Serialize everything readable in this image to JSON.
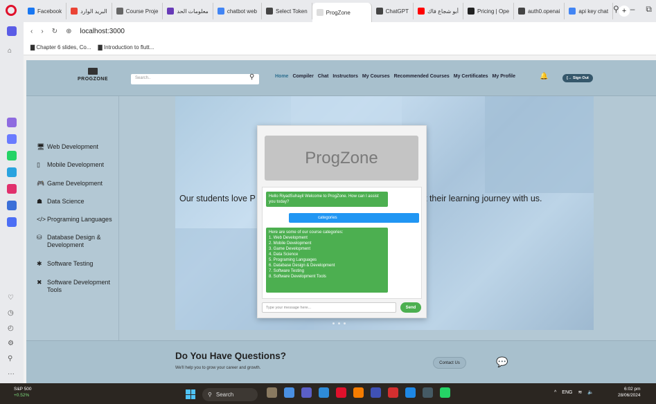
{
  "browser": {
    "tabs": [
      {
        "label": "Facebook",
        "color": "#1877f2"
      },
      {
        "label": "البريد الوارد",
        "color": "#ea4335"
      },
      {
        "label": "Course Proje",
        "color": "#666666"
      },
      {
        "label": "معلومات الحد",
        "color": "#673ab7"
      },
      {
        "label": "chatbot web",
        "color": "#4285f4"
      },
      {
        "label": "Select Token",
        "color": "#444444"
      },
      {
        "label": "ProgZone",
        "color": "#dddddd"
      },
      {
        "label": "ChatGPT",
        "color": "#444444"
      },
      {
        "label": "أبو شجاع فاك",
        "color": "#ff0000"
      },
      {
        "label": "Pricing | Ope",
        "color": "#222222"
      },
      {
        "label": "auth0.openai",
        "color": "#444444"
      },
      {
        "label": "api key chat",
        "color": "#4285f4"
      }
    ],
    "url": "localhost:3000",
    "bookmarks": [
      "Chapter 6 slides, Co...",
      "Introduction to flutt..."
    ]
  },
  "site": {
    "logo": "PROGZONE",
    "search_placeholder": "Search..",
    "nav": [
      "Home",
      "Compiler",
      "Chat",
      "Instructors",
      "My Courses",
      "Recommended Courses",
      "My Certificates",
      "My Profile"
    ],
    "signout": "[→ Sign Out"
  },
  "categories": [
    {
      "label": "Web Development",
      "icon": "🖥"
    },
    {
      "label": "Mobile Development",
      "icon": "▯"
    },
    {
      "label": "Game Development",
      "icon": "🎮"
    },
    {
      "label": "Data Science",
      "icon": "☗"
    },
    {
      "label": "Programing Languages",
      "icon": "</>"
    },
    {
      "label": "Database Design & Development",
      "icon": "⛁"
    },
    {
      "label": "Software Testing",
      "icon": "✱"
    },
    {
      "label": "Software Development Tools",
      "icon": "✖"
    }
  ],
  "hero": {
    "text_left": "Our students love P",
    "text_right": "t their learning journey with us."
  },
  "chat": {
    "header": "ProgZone",
    "bot_greeting": "Hello RiyadSuhayil Welcome to ProgZone. How can I assist you today?",
    "user_message": "categories",
    "bot_reply_title": "Here are some of our course categories:",
    "bot_reply_items": [
      "1. Web Development",
      "2. Mobile Development",
      "3. Game Development",
      "4. Data Science",
      "5. Programing Languages",
      "6. Database Design & Development",
      "7. Software Testing",
      "8. Software Development Tools"
    ],
    "input_placeholder": "Type your message here...",
    "send": "Send"
  },
  "faq": {
    "title": "Do You Have Questions?",
    "subtitle": "We'll help you to grow your career and growth.",
    "contact": "Contact Us"
  },
  "taskbar": {
    "stock_name": "S&P 500",
    "stock_change": "+0.52%",
    "search": "Search",
    "lang": "ENG",
    "time": "6:02 pm",
    "date": "28/06/2024"
  },
  "colors": {
    "accent_green": "#4caf50",
    "accent_blue": "#2196f3",
    "navbar": "#a8c0cd"
  }
}
